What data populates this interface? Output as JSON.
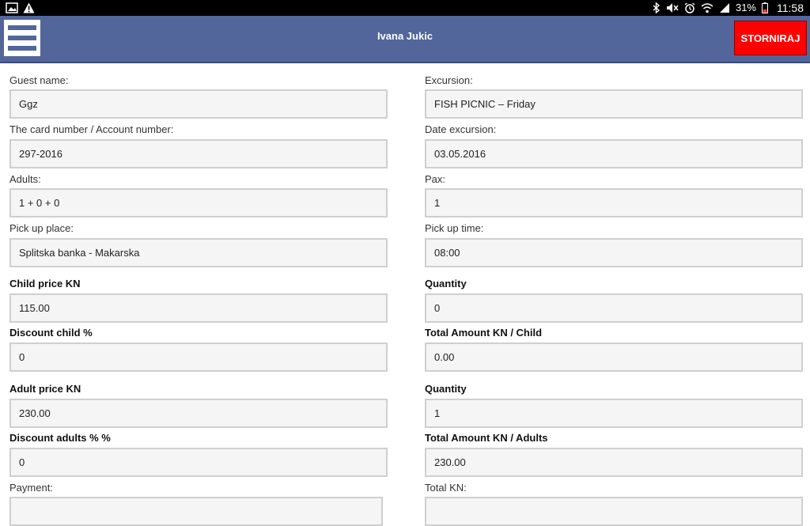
{
  "status_bar": {
    "battery_percent": "31%",
    "time": "11:58",
    "icons": [
      "image-icon",
      "warning-icon",
      "bluetooth-icon",
      "mute-icon",
      "alarm-icon",
      "wifi-icon",
      "signal-icon",
      "battery-icon"
    ]
  },
  "header": {
    "title": "Ivana Jukic",
    "menu_icon": "hamburger-menu-icon",
    "cancel_label": "STORNIRAJ",
    "colors": {
      "bar": "#52669b",
      "cancel": "#ff0000"
    }
  },
  "form": {
    "left": [
      {
        "label": "Guest name:",
        "value": "Ggz",
        "bold": false
      },
      {
        "label": "The card number / Account number:",
        "value": "297-2016",
        "bold": false
      },
      {
        "label": "Adults:",
        "value": "1 + 0 + 0",
        "bold": false
      },
      {
        "label": "Pick up place:",
        "value": "Splitska banka - Makarska",
        "bold": false
      },
      {
        "label": "Child price KN",
        "value": "115.00",
        "bold": true
      },
      {
        "label": "Discount child %",
        "value": "0",
        "bold": true
      },
      {
        "label": "Adult price KN",
        "value": "230.00",
        "bold": true
      },
      {
        "label": "Discount adults % %",
        "value": "0",
        "bold": true
      },
      {
        "label": "Payment:",
        "value": "",
        "bold": false
      }
    ],
    "right": [
      {
        "label": "Excursion:",
        "value": "FISH PICNIC  – Friday",
        "bold": false
      },
      {
        "label": "Date excursion:",
        "value": "03.05.2016",
        "bold": false
      },
      {
        "label": "Pax:",
        "value": "1",
        "bold": false
      },
      {
        "label": "Pick up time:",
        "value": "08:00",
        "bold": false
      },
      {
        "label": "Quantity",
        "value": "0",
        "bold": true
      },
      {
        "label": "Total Amount KN / Child",
        "value": "0.00",
        "bold": true
      },
      {
        "label": "Quantity",
        "value": "1",
        "bold": true
      },
      {
        "label": "Total Amount KN / Adults",
        "value": "230.00",
        "bold": true
      },
      {
        "label": "Total KN:",
        "value": "",
        "bold": false
      }
    ]
  }
}
